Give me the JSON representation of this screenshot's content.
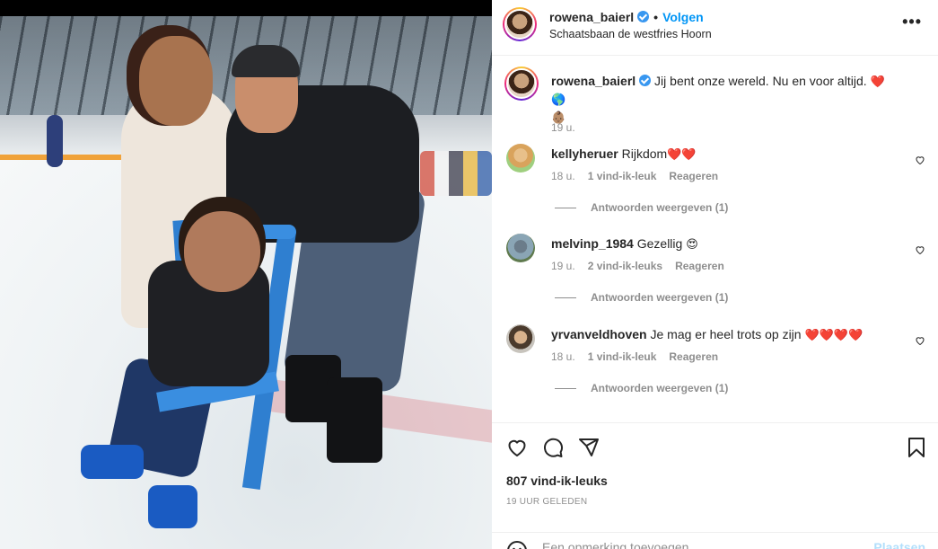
{
  "post": {
    "username": "rowena_baierl",
    "follow_label": "Volgen",
    "location": "Schaatsbaan de westfries Hoorn",
    "more_label": "•••"
  },
  "caption": {
    "username": "rowena_baierl",
    "text": "Jij bent onze wereld. Nu en voor altijd.",
    "emoji": "❤️🌎",
    "emoji2": "👶🏽",
    "time": "19 u."
  },
  "comments": [
    {
      "username": "kellyheruer",
      "text": "Rijkdom",
      "emoji": "❤️❤️",
      "time": "18 u.",
      "likes": "1 vind-ik-leuk",
      "reply": "Reageren",
      "view_replies": "Antwoorden weergeven (1)"
    },
    {
      "username": "melvinp_1984",
      "text": "Gezellig",
      "emoji": "😍",
      "time": "19 u.",
      "likes": "2 vind-ik-leuks",
      "reply": "Reageren",
      "view_replies": "Antwoorden weergeven (1)"
    },
    {
      "username": "yrvanveldhoven",
      "text": "Je mag er heel trots op zijn",
      "emoji": "❤️❤️❤️❤️",
      "time": "18 u.",
      "likes": "1 vind-ik-leuk",
      "reply": "Reageren",
      "view_replies": "Antwoorden weergeven (1)"
    }
  ],
  "stats": {
    "likes": "807 vind-ik-leuks",
    "date": "19 UUR GELEDEN"
  },
  "add_comment": {
    "placeholder": "Een opmerking toevoegen...",
    "post_label": "Plaatsen"
  },
  "icons": {
    "like": "heart-icon",
    "comment": "comment-icon",
    "share": "paper-plane-icon",
    "save": "bookmark-icon",
    "emoji": "smiley-icon"
  },
  "colors": {
    "follow": "#0095f6",
    "verified": "#3897f0",
    "muted": "#8e8e8e",
    "post_disabled": "#b2dffc"
  }
}
